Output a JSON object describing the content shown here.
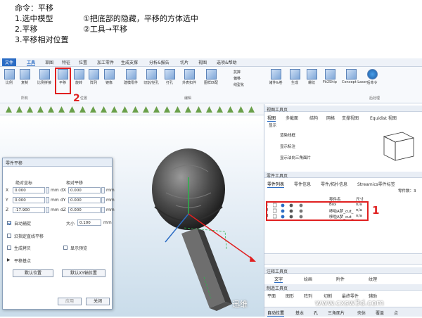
{
  "instructions": {
    "line1": "命令：平移",
    "line2a": "1.选中模型",
    "line2b": "①把底部的隐藏，平移的方体选中",
    "line3a": "2.平移",
    "line3b": "②工具→平移",
    "line4": "3.平移相对位置"
  },
  "menu": {
    "items": [
      "文件",
      "工具",
      "草图",
      "特征",
      "位置",
      "加工零件",
      "生成支撑",
      "分析&报告",
      "切片",
      "视图",
      "选项&帮助"
    ],
    "active_index": 1
  },
  "ribbon": {
    "buttons": [
      "比例",
      "复制",
      "比例拼接",
      "平移",
      "旋转",
      "阵列",
      "镜像",
      "建模零件",
      "切割/挖孔",
      "打孔",
      "外表扣件",
      "图样匹配",
      "抗摔",
      "偏移",
      "线型化",
      "诸件&卷",
      "生成",
      "螺纹",
      "Fit2Ship",
      "Concept Laser",
      "后命令"
    ],
    "groups": [
      "所有",
      "位置",
      "编辑",
      "",
      "后处理"
    ],
    "annotation_number": "2"
  },
  "viewport": {
    "annotation_number": "1"
  },
  "dialog": {
    "title": "零件平移",
    "col1": "绝对坐标",
    "col2": "相对平移",
    "rows": [
      {
        "axis": "X",
        "abs": "0.000",
        "unit": "mm",
        "rel_axis": "dX",
        "rel": "0.000"
      },
      {
        "axis": "Y",
        "abs": "0.000",
        "unit": "mm",
        "rel_axis": "dY",
        "rel": "0.000"
      },
      {
        "axis": "Z",
        "abs": "-17.900",
        "unit": "mm",
        "rel_axis": "dZ",
        "rel": "0.000"
      }
    ],
    "auto_capture": "自动捕捉",
    "size_label": "大小",
    "size_value": "0.100",
    "size_unit": "mm",
    "opt1": "沿指定直线平移",
    "opt2": "生成拷贝",
    "opt3": "显示预览",
    "base_point": "平移基点",
    "btn_default_pos": "默认位置",
    "btn_default_xy": "默认XY轴位置",
    "btn_apply": "应用",
    "btn_close": "关闭"
  },
  "panel": {
    "view_toolbar": "视图工具页",
    "view_tabs": [
      "视图",
      "多截面",
      "结构",
      "网格",
      "支撑视图",
      "Equidist 视图"
    ],
    "display_label": "显示",
    "display_items": [
      "渲染线框",
      "显示标注",
      "显示法向三角面片"
    ],
    "parts_toolbar": "零件工具页",
    "parts_tabs": [
      "零件列表",
      "零件信息",
      "零件/拓扑信息",
      "Streamics零件标签",
      "零件阵列"
    ],
    "count_label": "零件数：3",
    "col_name": "零件名",
    "col_unit": "尺寸",
    "parts": [
      {
        "idx": "1",
        "name": "Box",
        "unit": "n/a"
      },
      {
        "idx": "2",
        "name": "哆啦A梦_cut_",
        "unit": "n/a"
      },
      {
        "idx": "3",
        "name": "哆啦A梦_cut_",
        "unit": "n/a"
      }
    ],
    "annot_toolbar": "注释工具页",
    "annot_tabs": [
      "文字",
      "绘画",
      "附件",
      "纹理"
    ],
    "make_toolbar": "制造工具页",
    "make_tabs": [
      "平面",
      "图形",
      "阵列",
      "切割",
      "最终零件",
      "辅助"
    ],
    "bottom_tabs": [
      "自动位置",
      "基本",
      "孔",
      "三角面片",
      "壳体",
      "覆盖",
      "点"
    ]
  },
  "watermark": {
    "brand": "迅维",
    "url": "www.cxsw3d.com"
  }
}
